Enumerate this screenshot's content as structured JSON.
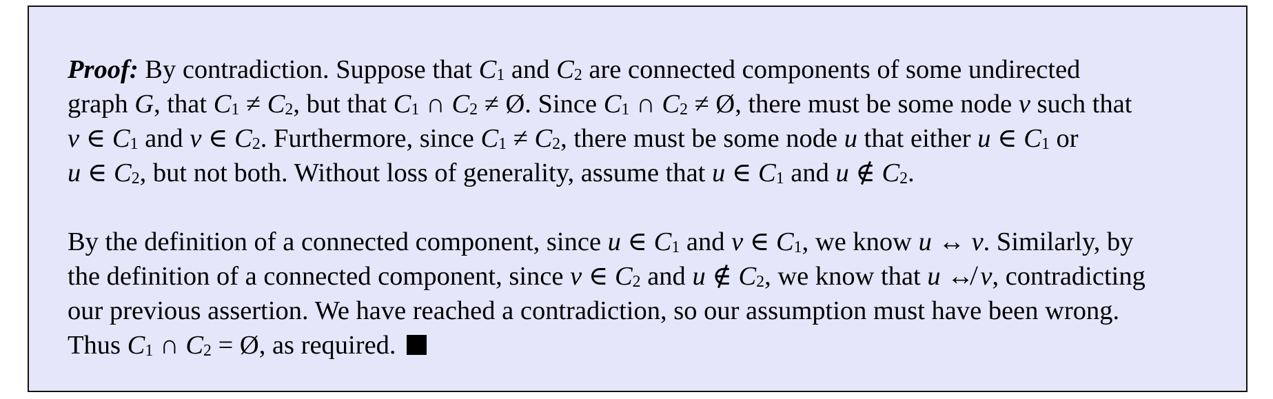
{
  "proof": {
    "lead": "Proof:",
    "qed_icon": "black-square-qed-icon",
    "paragraphs": [
      {
        "lines": [
          [
            {
              "t": "lead",
              "v": "Proof:"
            },
            {
              "t": "txt",
              "v": " By contradiction.  Suppose that "
            },
            {
              "t": "var",
              "v": "C",
              "sub": "1"
            },
            {
              "t": "txt",
              "v": " and "
            },
            {
              "t": "var",
              "v": "C",
              "sub": "2"
            },
            {
              "t": "txt",
              "v": " are connected components of some undirected"
            }
          ],
          [
            {
              "t": "txt",
              "v": "graph "
            },
            {
              "t": "var",
              "v": "G"
            },
            {
              "t": "txt",
              "v": ", that "
            },
            {
              "t": "var",
              "v": "C",
              "sub": "1"
            },
            {
              "t": "txt",
              "v": " ≠ "
            },
            {
              "t": "var",
              "v": "C",
              "sub": "2"
            },
            {
              "t": "txt",
              "v": ", but that "
            },
            {
              "t": "var",
              "v": "C",
              "sub": "1"
            },
            {
              "t": "txt",
              "v": " ∩ "
            },
            {
              "t": "var",
              "v": "C",
              "sub": "2"
            },
            {
              "t": "txt",
              "v": " ≠ Ø.  Since "
            },
            {
              "t": "var",
              "v": "C",
              "sub": "1"
            },
            {
              "t": "txt",
              "v": " ∩ "
            },
            {
              "t": "var",
              "v": "C",
              "sub": "2"
            },
            {
              "t": "txt",
              "v": " ≠ Ø, there must be some node "
            },
            {
              "t": "var",
              "v": "v"
            },
            {
              "t": "txt",
              "v": " such that"
            }
          ],
          [
            {
              "t": "var",
              "v": "v"
            },
            {
              "t": "txt",
              "v": " ∈ "
            },
            {
              "t": "var",
              "v": "C",
              "sub": "1"
            },
            {
              "t": "txt",
              "v": " and "
            },
            {
              "t": "var",
              "v": "v"
            },
            {
              "t": "txt",
              "v": " ∈ "
            },
            {
              "t": "var",
              "v": "C",
              "sub": "2"
            },
            {
              "t": "txt",
              "v": ".  Furthermore, since "
            },
            {
              "t": "var",
              "v": "C",
              "sub": "1"
            },
            {
              "t": "txt",
              "v": " ≠ "
            },
            {
              "t": "var",
              "v": "C",
              "sub": "2"
            },
            {
              "t": "txt",
              "v": ", there must be some node "
            },
            {
              "t": "var",
              "v": "u"
            },
            {
              "t": "txt",
              "v": " that either "
            },
            {
              "t": "var",
              "v": "u"
            },
            {
              "t": "txt",
              "v": " ∈ "
            },
            {
              "t": "var",
              "v": "C",
              "sub": "1"
            },
            {
              "t": "txt",
              "v": " or"
            }
          ],
          [
            {
              "t": "var",
              "v": "u"
            },
            {
              "t": "txt",
              "v": " ∈ "
            },
            {
              "t": "var",
              "v": "C",
              "sub": "2"
            },
            {
              "t": "txt",
              "v": ", but not both.  Without loss of generality, assume that "
            },
            {
              "t": "var",
              "v": "u"
            },
            {
              "t": "txt",
              "v": " ∈ "
            },
            {
              "t": "var",
              "v": "C",
              "sub": "1"
            },
            {
              "t": "txt",
              "v": " and "
            },
            {
              "t": "var",
              "v": "u"
            },
            {
              "t": "txt",
              "v": " ∉ "
            },
            {
              "t": "var",
              "v": "C",
              "sub": "2"
            },
            {
              "t": "txt",
              "v": "."
            }
          ]
        ]
      },
      {
        "lines": [
          [
            {
              "t": "txt",
              "v": "By the definition of a connected component, since "
            },
            {
              "t": "var",
              "v": "u"
            },
            {
              "t": "txt",
              "v": " ∈ "
            },
            {
              "t": "var",
              "v": "C",
              "sub": "1"
            },
            {
              "t": "txt",
              "v": " and "
            },
            {
              "t": "var",
              "v": "v"
            },
            {
              "t": "txt",
              "v": " ∈ "
            },
            {
              "t": "var",
              "v": "C",
              "sub": "1"
            },
            {
              "t": "txt",
              "v": ", we know "
            },
            {
              "t": "var",
              "v": "u"
            },
            {
              "t": "txt",
              "v": " ↔ "
            },
            {
              "t": "var",
              "v": "v"
            },
            {
              "t": "txt",
              "v": ".  Similarly, by"
            }
          ],
          [
            {
              "t": "txt",
              "v": "the definition of a connected component, since "
            },
            {
              "t": "var",
              "v": "v"
            },
            {
              "t": "txt",
              "v": " ∈ "
            },
            {
              "t": "var",
              "v": "C",
              "sub": "2"
            },
            {
              "t": "txt",
              "v": " and "
            },
            {
              "t": "var",
              "v": "u"
            },
            {
              "t": "txt",
              "v": " ∉ "
            },
            {
              "t": "var",
              "v": "C",
              "sub": "2"
            },
            {
              "t": "txt",
              "v": ", we know that "
            },
            {
              "t": "var",
              "v": "u"
            },
            {
              "t": "txt",
              "v": " ↮ "
            },
            {
              "t": "var",
              "v": "v"
            },
            {
              "t": "txt",
              "v": ", contradicting"
            }
          ],
          [
            {
              "t": "txt",
              "v": "our previous assertion.  We have reached a contradiction, so our assumption must have been wrong."
            }
          ],
          [
            {
              "t": "txt",
              "v": "Thus "
            },
            {
              "t": "var",
              "v": "C",
              "sub": "1"
            },
            {
              "t": "txt",
              "v": " ∩ "
            },
            {
              "t": "var",
              "v": "C",
              "sub": "2"
            },
            {
              "t": "txt",
              "v": " = Ø, as required. "
            },
            {
              "t": "qed"
            }
          ]
        ]
      }
    ]
  }
}
